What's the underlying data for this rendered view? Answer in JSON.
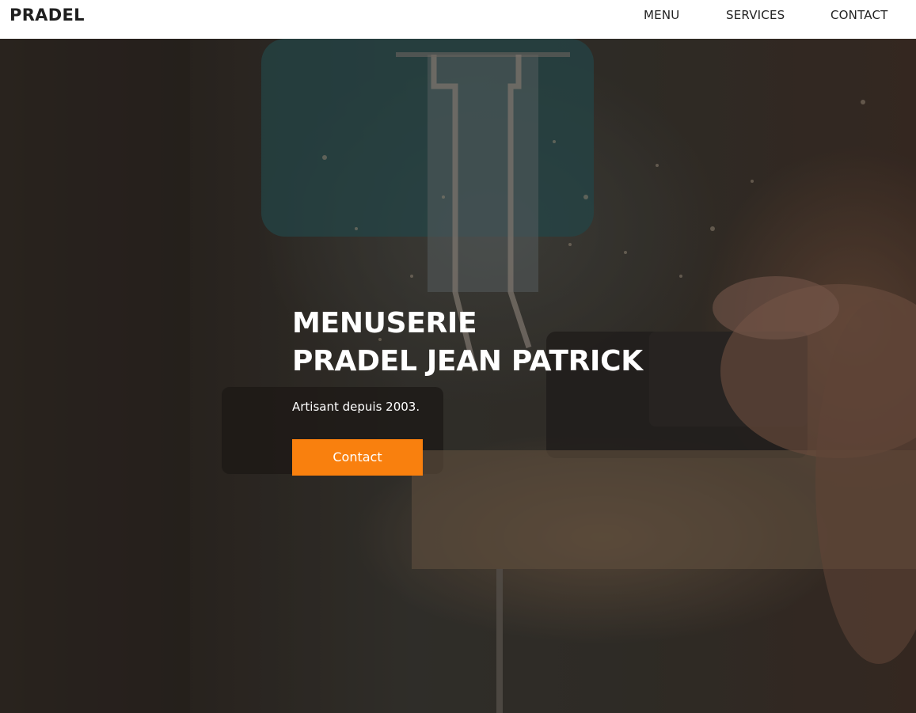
{
  "nav": {
    "brand": "PRADEL",
    "links": [
      {
        "label": "MENU"
      },
      {
        "label": "SERVICES"
      },
      {
        "label": "CONTACT"
      }
    ]
  },
  "hero": {
    "title_line1": "MENUSERIE",
    "title_line2": "PRADEL JEAN PATRICK",
    "subtitle": "Artisant depuis 2003.",
    "cta_label": "Contact",
    "accent_color": "#f9800e",
    "background_image": "jigsaw cutting wood"
  }
}
